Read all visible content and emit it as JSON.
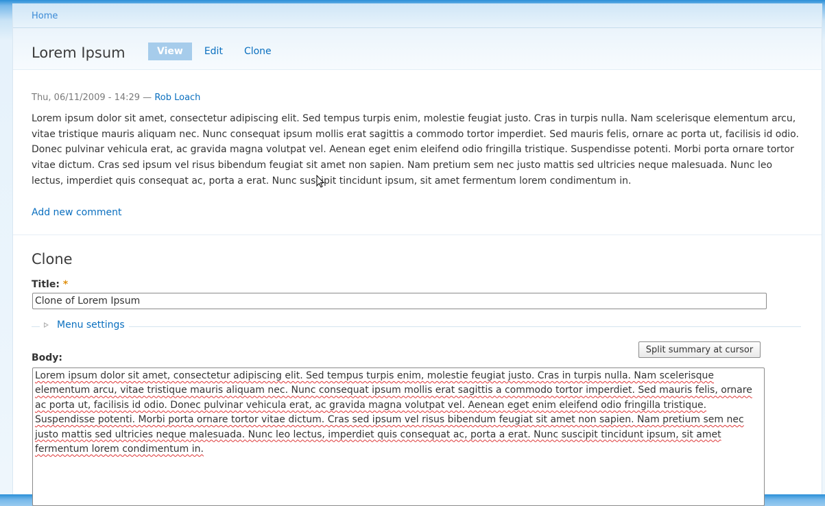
{
  "breadcrumb": {
    "home": "Home"
  },
  "page": {
    "title": "Lorem Ipsum"
  },
  "tabs": [
    {
      "label": "View",
      "active": true
    },
    {
      "label": "Edit",
      "active": false
    },
    {
      "label": "Clone",
      "active": false
    }
  ],
  "node": {
    "submitted_date": "Thu, 06/11/2009 - 14:29 —",
    "author": "Rob Loach",
    "body": "Lorem ipsum dolor sit amet, consectetur adipiscing elit. Sed tempus turpis enim, molestie feugiat justo. Cras in turpis nulla. Nam scelerisque elementum arcu, vitae tristique mauris aliquam nec. Nunc consequat ipsum mollis erat sagittis a commodo tortor imperdiet. Sed mauris felis, ornare ac porta ut, facilisis id odio. Donec pulvinar vehicula erat, ac gravida magna volutpat vel. Aenean eget enim eleifend odio fringilla tristique. Suspendisse potenti. Morbi porta ornare tortor vitae dictum. Cras sed ipsum vel risus bibendum feugiat sit amet non sapien. Nam pretium sem nec justo mattis sed ultricies neque malesuada. Nunc leo lectus, imperdiet quis consequat ac, porta a erat. Nunc suscipit tincidunt ipsum, sit amet fermentum lorem condimentum in.",
    "add_comment": "Add new comment"
  },
  "clone_form": {
    "heading": "Clone",
    "title_label": "Title:",
    "required_marker": "*",
    "title_value": "Clone of Lorem Ipsum",
    "menu_settings": "Menu settings",
    "split_button": "Split summary at cursor",
    "body_label": "Body:",
    "body_value": "Lorem ipsum dolor sit amet, consectetur adipiscing elit. Sed tempus turpis enim, molestie feugiat justo. Cras in turpis nulla. Nam scelerisque elementum arcu, vitae tristique mauris aliquam nec. Nunc consequat ipsum mollis erat sagittis a commodo tortor imperdiet. Sed mauris felis, ornare ac porta ut, facilisis id odio. Donec pulvinar vehicula erat, ac gravida magna volutpat vel. Aenean eget enim eleifend odio fringilla tristique. Suspendisse potenti. Morbi porta ornare tortor vitae dictum. Cras sed ipsum vel risus bibendum feugiat sit amet non sapien. Nam pretium sem nec justo mattis sed ultricies neque malesuada. Nunc leo lectus, imperdiet quis consequat ac, porta a erat. Nunc suscipit tincidunt ipsum, sit amet fermentum lorem condimentum in."
  },
  "colors": {
    "link": "#0a6fbf",
    "active_tab_bg": "#a6cceb",
    "required": "#e09010",
    "header_top": "#2a8fd8"
  },
  "icons": {
    "collapse": "triangle-right-icon",
    "pointer": "mouse-pointer-icon"
  }
}
